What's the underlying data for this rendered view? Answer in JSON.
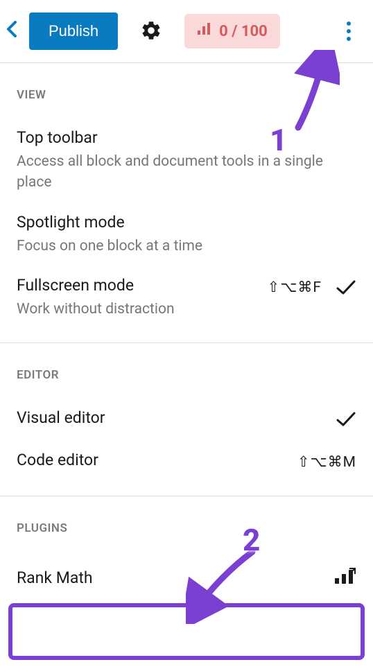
{
  "toolbar": {
    "publish_label": "Publish",
    "score_text": "0 / 100"
  },
  "sections": {
    "view": {
      "header": "VIEW",
      "items": [
        {
          "title": "Top toolbar",
          "desc": "Access all block and document tools in a single place"
        },
        {
          "title": "Spotlight mode",
          "desc": "Focus on one block at a time"
        },
        {
          "title": "Fullscreen mode",
          "desc": "Work without distraction",
          "shortcut": "⇧⌥⌘F",
          "checked": true
        }
      ]
    },
    "editor": {
      "header": "EDITOR",
      "items": [
        {
          "title": "Visual editor",
          "checked": true
        },
        {
          "title": "Code editor",
          "shortcut": "⇧⌥⌘M"
        }
      ]
    },
    "plugins": {
      "header": "PLUGINS",
      "items": [
        {
          "title": "Rank Math"
        }
      ]
    }
  },
  "annotations": {
    "label1": "1",
    "label2": "2"
  }
}
